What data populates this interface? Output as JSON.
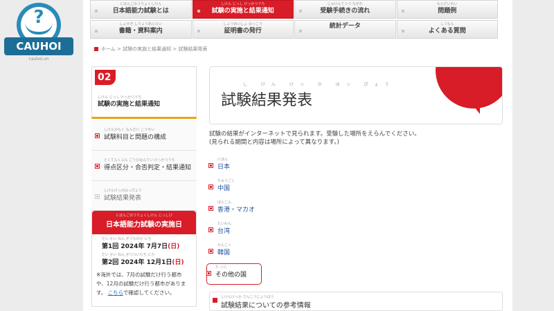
{
  "logo": {
    "badge": "CAUHOI",
    "mark": "?",
    "sub": "cauhoi.vn"
  },
  "nav": {
    "row1": [
      {
        "ruby": "にほんごのうりょくしけん",
        "label": "日本語能力試験とは"
      },
      {
        "ruby": "しけん じっし けっかつうち",
        "label": "試験の実施と結果通知",
        "active": true
      },
      {
        "ruby": "じゅけんてつづ ながれ",
        "label": "受験手続きの流れ"
      },
      {
        "ruby": "もんだいれい",
        "label": "問題例"
      }
    ],
    "row2": [
      {
        "ruby": "しょせき しりょうあんない",
        "label": "書籍・資料案内"
      },
      {
        "ruby": "しょうめいしょ はっこう",
        "label": "証明書の発行"
      },
      {
        "ruby": "",
        "label": "統計データ"
      },
      {
        "ruby": "しつもん",
        "label": "よくある質問"
      }
    ]
  },
  "breadcrumb": "ホーム > 試験の実施と結果通知 > 試験結果発表",
  "sidebar": {
    "number": "02",
    "title_ruby": "しけん じっし けっかつうち",
    "title": "試験の実施と結果通知",
    "items": [
      {
        "ruby": "しけんかもく もんだい こうせい",
        "label": "試験科目と問題の構成"
      },
      {
        "ruby": "とくてんくぶん ごうひはんてい けっかつうち",
        "label": "得点区分・合否判定・結果通知"
      },
      {
        "ruby": "しけんけっかはっぴょう",
        "label": "試験結果発表",
        "current": true
      }
    ]
  },
  "exam_dates": {
    "ruby": "にほんごのうりょくしけん じっしび",
    "title": "日本語能力試験の実施日",
    "rows": [
      {
        "ruby": "だい かい ねん がつなのか にち",
        "text": "第1回 2024年 7月7日",
        "dow": "(日)"
      },
      {
        "ruby": "だい かい ねん がつついたち にち",
        "text": "第2回 2024年 12月1日",
        "dow": "(日)"
      }
    ],
    "note": "※海外では、7月の試験だけ行う都市や、12月の試験だけ行う都市があります。",
    "note_link": "こちら",
    "note_tail": "で確認してください。"
  },
  "main": {
    "title_ruby": "し けん けっ か はっ ぴょう",
    "title": "試験結果発表",
    "intro_line1": "試験の結果がインターネットで見られます。受験した場所をえらんでください。",
    "intro_line2": "(見られる期間と内容は場所によって異なります。)",
    "regions": [
      {
        "ruby": "にほん",
        "label": "日本"
      },
      {
        "ruby": "ちゅうごく",
        "label": "中国"
      },
      {
        "ruby": "ほんこん",
        "label": "香港・マカオ"
      },
      {
        "ruby": "たいわん",
        "label": "台湾"
      },
      {
        "ruby": "かんこく",
        "label": "韓国"
      },
      {
        "ruby": "た くに",
        "label": "その他の国",
        "highlight": true
      }
    ],
    "ref_ruby": "しけんけっか さんこうじょうほう",
    "ref_title": "試験結果についての参考情報"
  }
}
